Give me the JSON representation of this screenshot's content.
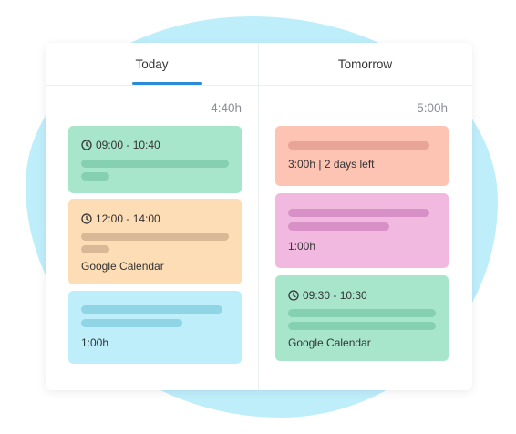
{
  "tabs": [
    {
      "label": "Today",
      "total": "4:40h"
    },
    {
      "label": "Tomorrow",
      "total": "5:00h"
    }
  ],
  "today_events": {
    "event1": {
      "time": "09:00 - 10:40",
      "color": "#a8e6cc"
    },
    "event2": {
      "time": "12:00 - 14:00",
      "source": "Google Calendar",
      "color": "#fdddb6"
    },
    "event3": {
      "duration": "1:00h",
      "color": "#bdeefa"
    }
  },
  "tomorrow_events": {
    "event1": {
      "detail": "3:00h | 2 days left",
      "color": "#fdc3b3"
    },
    "event2": {
      "duration": "1:00h",
      "color": "#f1b9e0"
    },
    "event3": {
      "time": "09:30 - 10:30",
      "source": "Google Calendar",
      "color": "#a8e6cc"
    }
  },
  "colors": {
    "accent": "#2a8bd6",
    "background_blob": "#bfeefb"
  }
}
